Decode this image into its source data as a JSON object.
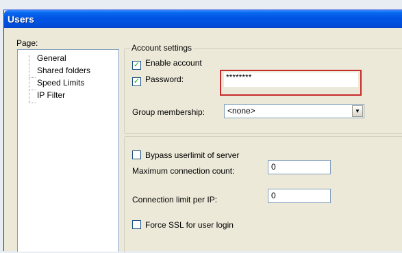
{
  "window": {
    "title": "Users"
  },
  "sidebar": {
    "label": "Page:",
    "items": [
      {
        "label": "General"
      },
      {
        "label": "Shared folders"
      },
      {
        "label": "Speed Limits"
      },
      {
        "label": "IP Filter"
      }
    ]
  },
  "account_settings": {
    "caption": "Account settings",
    "enable_account": {
      "label": "Enable account",
      "checked": true
    },
    "password": {
      "label": "Password:",
      "checked": true,
      "value": "********"
    },
    "group_membership": {
      "label": "Group membership:",
      "value": "<none>"
    }
  },
  "limits": {
    "bypass_userlimit": {
      "label": "Bypass userlimit of server",
      "checked": false
    },
    "max_connection_count": {
      "label": "Maximum connection count:",
      "value": "0"
    },
    "connection_limit_per_ip": {
      "label": "Connection limit per IP:",
      "value": "0"
    },
    "force_ssl": {
      "label": "Force SSL for user login",
      "checked": false
    }
  },
  "colors": {
    "titlebar": "#0054e3",
    "highlight_box": "#c62a2a",
    "dialog_bg": "#ece9d8",
    "desktop_bg": "#e8edf3"
  }
}
